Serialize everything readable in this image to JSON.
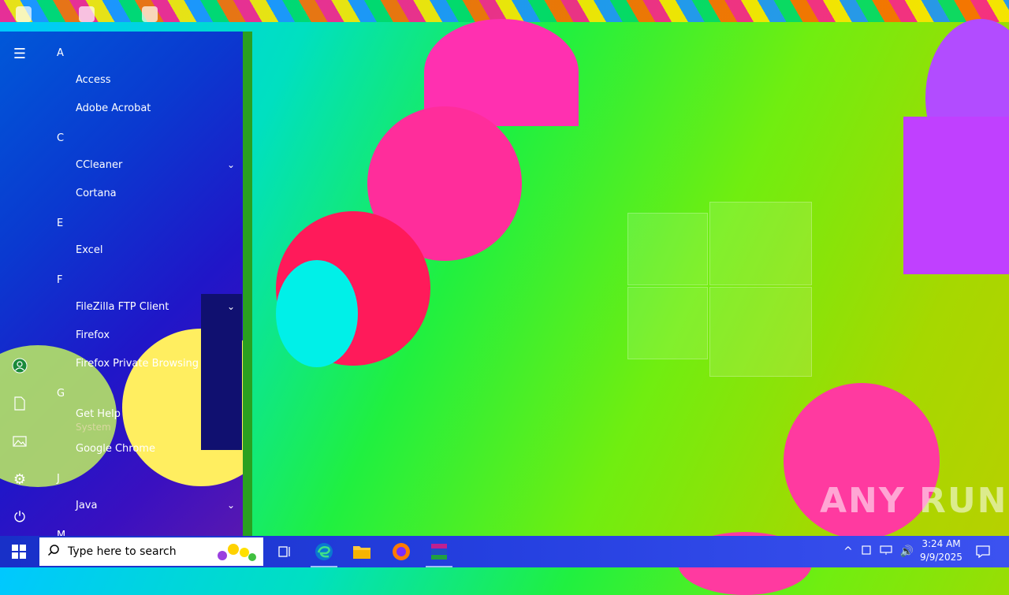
{
  "start_menu": {
    "sections": [
      {
        "letter": "A",
        "apps": [
          {
            "label": "Access"
          },
          {
            "label": "Adobe Acrobat"
          }
        ]
      },
      {
        "letter": "C",
        "apps": [
          {
            "label": "CCleaner",
            "expandable": true
          },
          {
            "label": "Cortana"
          }
        ]
      },
      {
        "letter": "E",
        "apps": [
          {
            "label": "Excel"
          }
        ]
      },
      {
        "letter": "F",
        "apps": [
          {
            "label": "FileZilla FTP Client",
            "expandable": true
          },
          {
            "label": "Firefox"
          },
          {
            "label": "Firefox Private Browsing"
          }
        ]
      },
      {
        "letter": "G",
        "apps": [
          {
            "label": "Get Help",
            "sub": "System"
          },
          {
            "label": "Google Chrome"
          }
        ]
      },
      {
        "letter": "J",
        "apps": [
          {
            "label": "Java",
            "expandable": true
          }
        ]
      },
      {
        "letter": "M",
        "apps": []
      }
    ],
    "rail_icons": [
      "hamburger-icon",
      "user-icon",
      "document-icon",
      "pictures-icon",
      "settings-icon",
      "power-icon"
    ]
  },
  "taskbar": {
    "search_placeholder": "Type here to search",
    "icons": [
      "task-view-icon",
      "edge-icon",
      "file-explorer-icon",
      "firefox-icon",
      "winrar-icon"
    ],
    "clock_time": "3:24 AM",
    "clock_date": "9/9/2025"
  },
  "watermark": "ANY RUN",
  "colors": {
    "accent": "#1830c8",
    "desktop": "#20f040"
  }
}
